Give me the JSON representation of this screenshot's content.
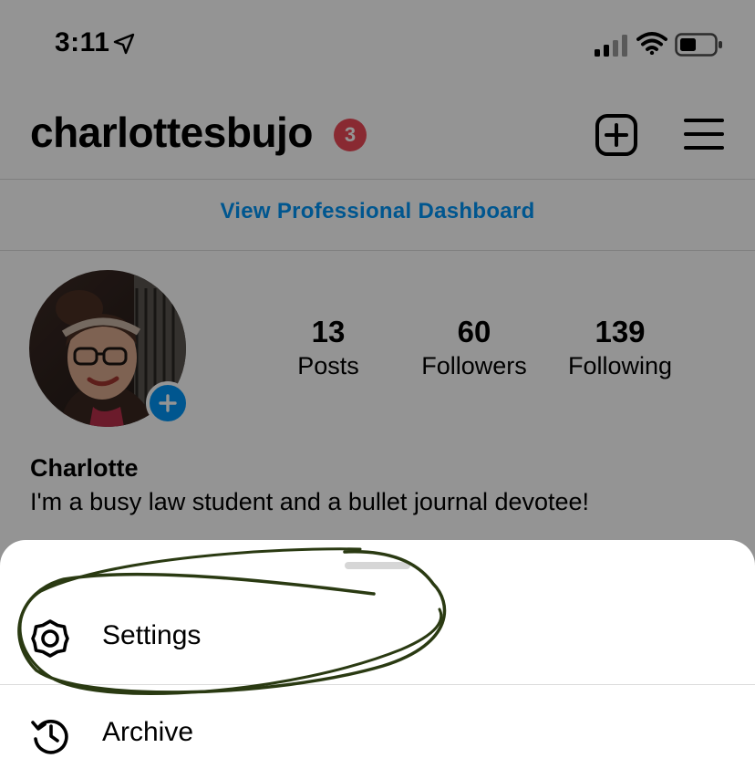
{
  "status_bar": {
    "time": "3:11",
    "icons": [
      "location-arrow-icon",
      "cellular-signal-icon",
      "wifi-icon",
      "battery-icon"
    ]
  },
  "header": {
    "username": "charlottesbujo",
    "notification_count": "3",
    "create_icon": "plus-square-icon",
    "menu_icon": "hamburger-menu-icon"
  },
  "professional_dashboard_link": "View Professional Dashboard",
  "profile": {
    "stats": [
      {
        "value": "13",
        "label": "Posts"
      },
      {
        "value": "60",
        "label": "Followers"
      },
      {
        "value": "139",
        "label": "Following"
      }
    ],
    "display_name": "Charlotte",
    "bio": "I'm a busy law student and a bullet journal devotee!"
  },
  "menu_sheet": {
    "items": [
      {
        "label": "Settings",
        "icon": "settings-gear-icon"
      },
      {
        "label": "Archive",
        "icon": "archive-history-icon"
      }
    ]
  },
  "colors": {
    "accent_blue": "#0095f6",
    "badge_red": "#ed4956",
    "scribble_green": "#2a3a12"
  }
}
